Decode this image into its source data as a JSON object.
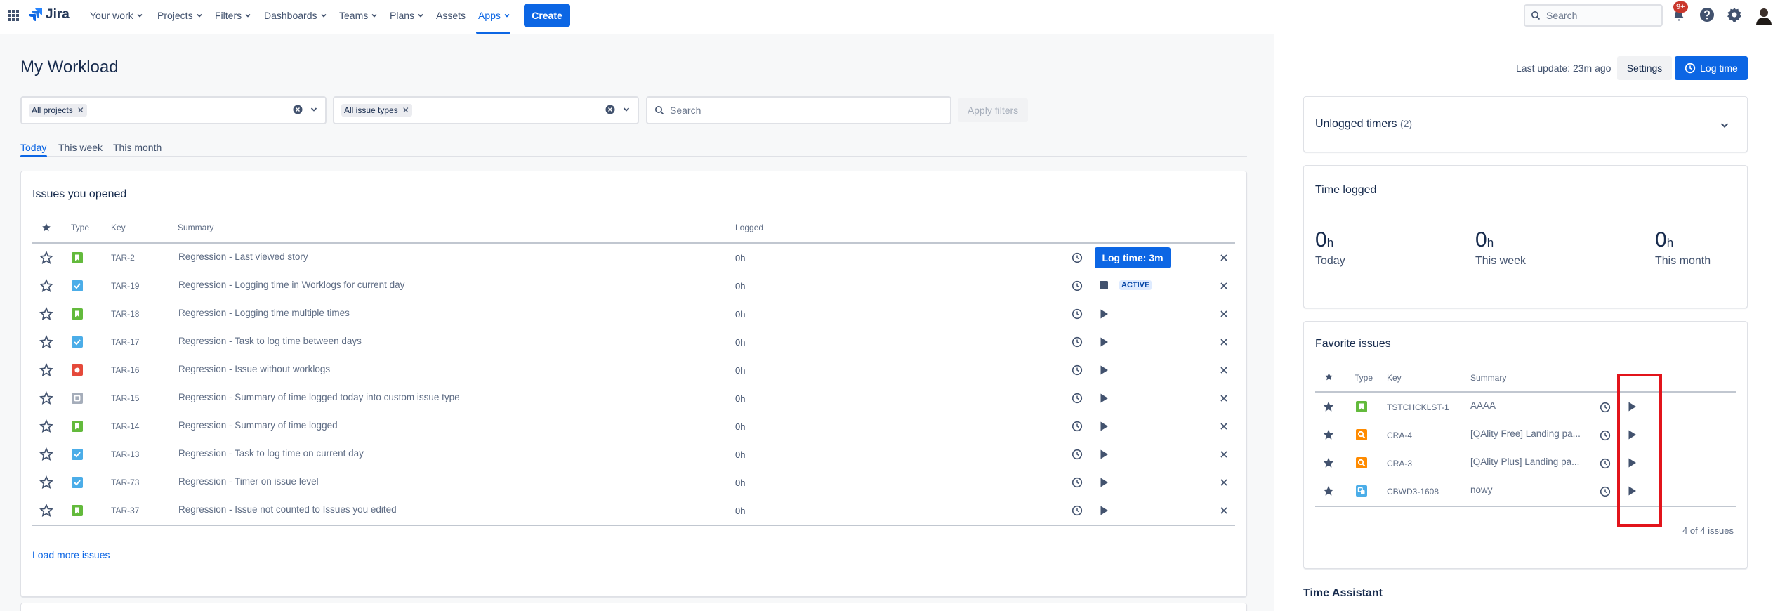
{
  "nav": {
    "logo": "Jira",
    "items": [
      "Your work",
      "Projects",
      "Filters",
      "Dashboards",
      "Teams",
      "Plans",
      "Assets",
      "Apps"
    ],
    "create": "Create",
    "search_placeholder": "Search",
    "notification_count": "9+"
  },
  "page": {
    "title": "My Workload",
    "filters": {
      "project_chip": "All projects",
      "issuetype_chip": "All issue types",
      "search_placeholder": "Search",
      "apply": "Apply filters"
    },
    "tabs": [
      "Today",
      "This week",
      "This month"
    ]
  },
  "opened": {
    "title": "Issues you opened",
    "headers": [
      "Type",
      "Key",
      "Summary",
      "Logged"
    ],
    "rows": [
      {
        "type": "story",
        "key": "TAR-2",
        "summary": "Regression - Last viewed story",
        "logged": "0h"
      },
      {
        "type": "task",
        "key": "TAR-19",
        "summary": "Regression - Logging time in Worklogs for current day",
        "logged": "0h"
      },
      {
        "type": "story",
        "key": "TAR-18",
        "summary": "Regression - Logging time multiple times",
        "logged": "0h"
      },
      {
        "type": "task",
        "key": "TAR-17",
        "summary": "Regression - Task to log time between days",
        "logged": "0h"
      },
      {
        "type": "bug",
        "key": "TAR-16",
        "summary": "Regression - Issue without worklogs",
        "logged": "0h"
      },
      {
        "type": "custom",
        "key": "TAR-15",
        "summary": "Regression - Summary of time logged today into custom issue type",
        "logged": "0h"
      },
      {
        "type": "story",
        "key": "TAR-14",
        "summary": "Regression - Summary of time logged",
        "logged": "0h"
      },
      {
        "type": "task",
        "key": "TAR-13",
        "summary": "Regression - Task to log time on current day",
        "logged": "0h"
      },
      {
        "type": "task",
        "key": "TAR-73",
        "summary": "Regression - Timer on issue level",
        "logged": "0h"
      },
      {
        "type": "story",
        "key": "TAR-37",
        "summary": "Regression - Issue not counted to Issues you edited",
        "logged": "0h"
      }
    ],
    "log_time_button": "Log time: 3m",
    "active_label": "ACTIVE",
    "load_more": "Load more issues"
  },
  "right": {
    "last_update": "Last update: 23m ago",
    "settings": "Settings",
    "log_time": "Log time",
    "unlogged": {
      "title": "Unlogged timers",
      "count": "(2)"
    },
    "time_logged": {
      "title": "Time logged",
      "stats": [
        {
          "value": "0",
          "unit": "h",
          "label": "Today"
        },
        {
          "value": "0",
          "unit": "h",
          "label": "This week"
        },
        {
          "value": "0",
          "unit": "h",
          "label": "This month"
        }
      ]
    },
    "favorites": {
      "title": "Favorite issues",
      "headers": [
        "Type",
        "Key",
        "Summary"
      ],
      "rows": [
        {
          "type": "story",
          "key": "TSTCHCKLST-1",
          "summary": "AAAA"
        },
        {
          "type": "test",
          "key": "CRA-4",
          "summary": "[QAlity Free] Landing pa..."
        },
        {
          "type": "test",
          "key": "CRA-3",
          "summary": "[QAlity Plus] Landing pa..."
        },
        {
          "type": "subtask",
          "key": "CBWD3-1608",
          "summary": "nowy"
        }
      ],
      "footer": "4 of 4 issues"
    },
    "assistant_title": "Time Assistant"
  },
  "colors": {
    "brand": "#0c66e4",
    "story": "#63ba3c",
    "task": "#4bade8",
    "bug": "#e5493a",
    "custom": "#a5adba",
    "test": "#ff8b00",
    "highlight": "#e2141b"
  }
}
